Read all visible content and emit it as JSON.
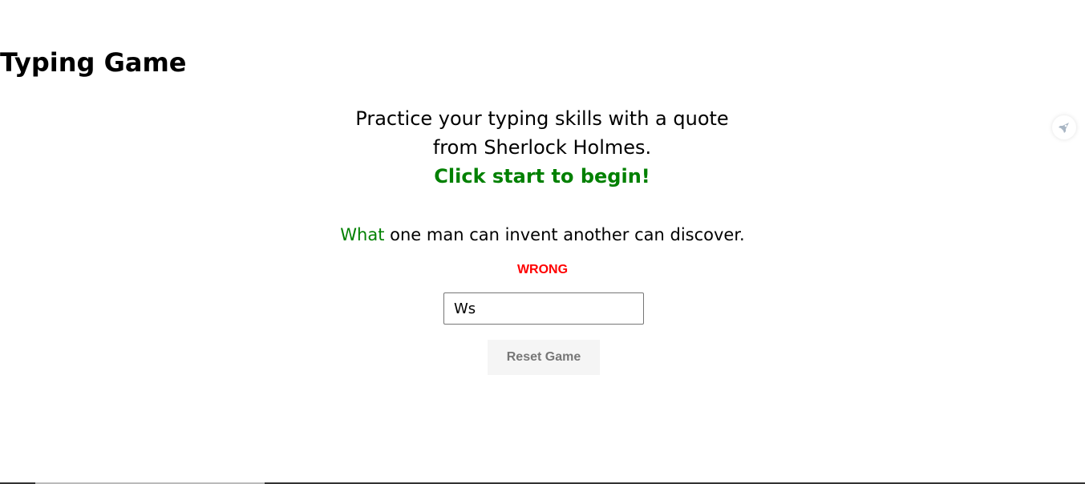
{
  "header": {
    "title": "Typing Game"
  },
  "intro": {
    "line1": "Practice your typing skills with a quote",
    "line2": "from Sherlock Holmes.",
    "call_to_action": "Click start to begin!"
  },
  "quote": {
    "typed_word": "What",
    "remaining_text": " one man can invent another can discover."
  },
  "status": {
    "message": "WRONG"
  },
  "input": {
    "value": "Ws"
  },
  "controls": {
    "reset_label": "Reset Game"
  },
  "side_widget": {
    "icon": "rocket-icon"
  },
  "colors": {
    "success": "#008000",
    "error": "#ff0000",
    "button_bg": "#f5f5f5",
    "button_text": "#777777"
  }
}
